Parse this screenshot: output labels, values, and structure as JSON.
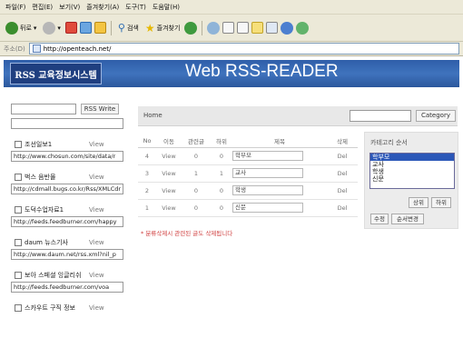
{
  "browser": {
    "menu": [
      "파일(F)",
      "편집(E)",
      "보기(V)",
      "즐겨찾기(A)",
      "도구(T)",
      "도움말(H)"
    ],
    "toolbar": {
      "back": "뒤로",
      "search": "검색",
      "favorites": "즐겨찾기"
    },
    "address": {
      "label": "주소(D)",
      "url": "http://openteach.net/"
    }
  },
  "header": {
    "logo": "RSS 교육정보시스템",
    "title": "Web RSS-READER"
  },
  "sidebar": {
    "write_button": "RSS Write",
    "feeds": [
      {
        "name": "조선일보1",
        "view": "View",
        "url": "http://www.chosun.com/site/data/r"
      },
      {
        "name": "벅스 음반몰",
        "view": "View",
        "url": "http://cdmall.bugs.co.kr/Rss/XMLCdr"
      },
      {
        "name": "도덕수업자료1",
        "view": "View",
        "url": "http://feeds.feedburner.com/happy"
      },
      {
        "name": "daum 뉴스기사",
        "view": "View",
        "url": "http://www.daum.net/rss.xml?nil_p"
      },
      {
        "name": "보아 스페셜 잉글리쉬",
        "view": "View",
        "url": "http://feeds.feedburner.com/voa"
      },
      {
        "name": "스카우트 구직 정보",
        "view": "View"
      }
    ]
  },
  "main": {
    "home_label": "Home",
    "category_button": "Category",
    "columns": [
      "No",
      "이동",
      "관련글",
      "하위",
      "제목",
      "삭제"
    ],
    "rows": [
      {
        "no": "4",
        "move": "View",
        "related": "0",
        "sub": "0",
        "title": "학부모",
        "del": "Del"
      },
      {
        "no": "3",
        "move": "View",
        "related": "1",
        "sub": "1",
        "title": "교사",
        "del": "Del"
      },
      {
        "no": "2",
        "move": "View",
        "related": "0",
        "sub": "0",
        "title": "학생",
        "del": "Del"
      },
      {
        "no": "1",
        "move": "View",
        "related": "0",
        "sub": "0",
        "title": "신문",
        "del": "Del"
      }
    ],
    "warning": "* 분류삭제시 관련된 글도 삭제됩니다"
  },
  "category_panel": {
    "title": "카테고리 순서",
    "options": [
      "학부모",
      "교사",
      "학생",
      "신문"
    ],
    "selected": "학부모",
    "up_button": "상위",
    "down_button": "하위",
    "edit_button": "수정",
    "order_button": "순서변경"
  }
}
